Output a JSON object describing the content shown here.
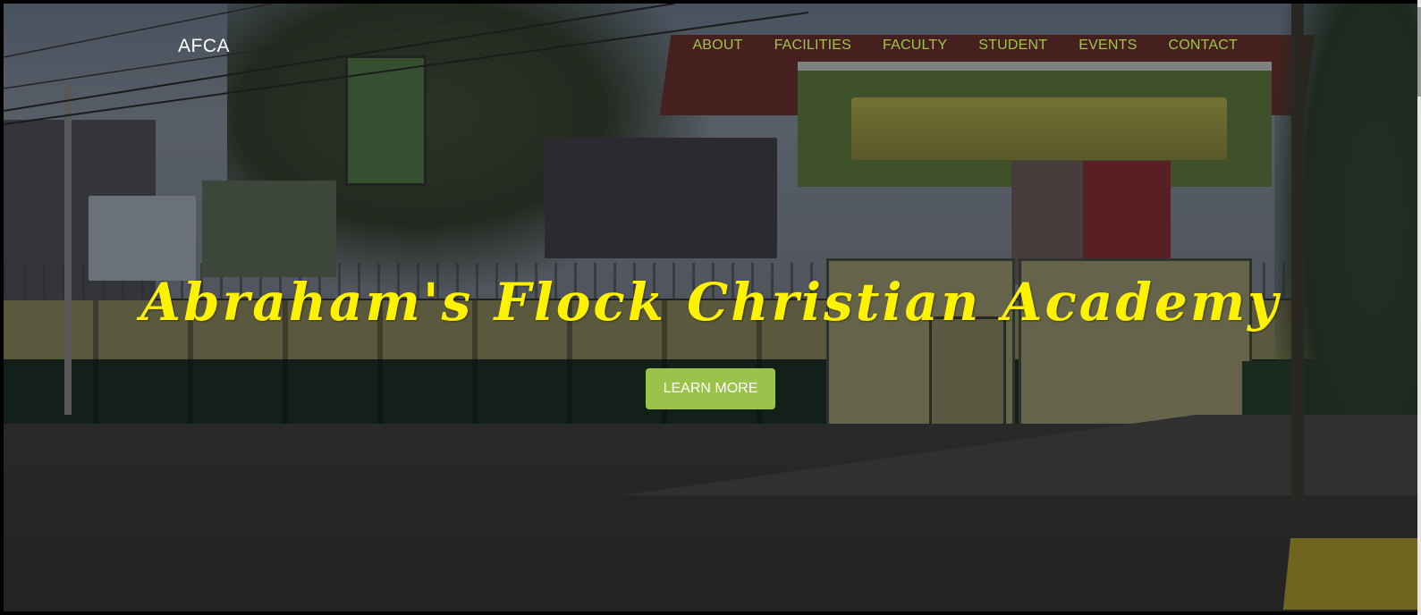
{
  "navbar": {
    "brand": "AFCA",
    "items": [
      {
        "label": "ABOUT"
      },
      {
        "label": "FACILITIES"
      },
      {
        "label": "FACULTY"
      },
      {
        "label": "STUDENT"
      },
      {
        "label": "EVENTS"
      },
      {
        "label": "CONTACT"
      }
    ]
  },
  "hero": {
    "title": "Abraham's Flock Christian Academy",
    "button_label": "LEARN MORE",
    "background_image": "school-entrance-photo"
  },
  "colors": {
    "accent": "#9bc24a",
    "title": "#fff200",
    "brand": "#ffffff"
  }
}
